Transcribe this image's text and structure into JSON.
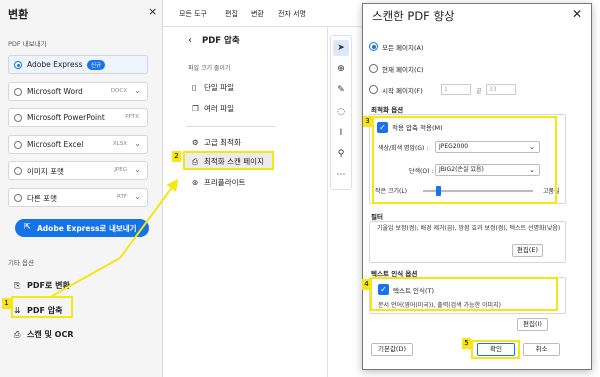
{
  "left": {
    "title": "변환",
    "close": "×",
    "export_heading": "PDF 내보내기",
    "formats": [
      {
        "label": "Adobe Express",
        "ext": "",
        "badge": "신규",
        "selected": true
      },
      {
        "label": "Microsoft Word",
        "ext": "DOCX",
        "badge": "",
        "selected": false
      },
      {
        "label": "Microsoft PowerPoint",
        "ext": "PPTX",
        "badge": "",
        "selected": false
      },
      {
        "label": "Microsoft Excel",
        "ext": "XLSX",
        "badge": "",
        "selected": false
      },
      {
        "label": "이미지 포맷",
        "ext": "JPEG",
        "badge": "",
        "selected": false
      },
      {
        "label": "다른 포맷",
        "ext": "RTF",
        "badge": "",
        "selected": false
      }
    ],
    "export_button": "Adobe Express로 내보내기",
    "other_heading": "기타 옵션",
    "other_items": [
      {
        "label": "PDF로 변환",
        "icon": "pdf-convert-icon"
      },
      {
        "label": "PDF 압축",
        "icon": "pdf-compress-icon"
      },
      {
        "label": "스캔 및 OCR",
        "icon": "scan-ocr-icon"
      }
    ]
  },
  "menu": [
    "모든 도구",
    "편집",
    "변환",
    "전자 서명"
  ],
  "middle": {
    "back": "‹",
    "title": "PDF 압축",
    "subtitle": "파일 크기 줄이기",
    "items": [
      "단일 파일",
      "여러 파일",
      "고급 최적화",
      "최적화 스캔 페이지",
      "프리플라이트"
    ]
  },
  "dialog": {
    "title": "스캔한 PDF 향상",
    "close": "✕",
    "pages": {
      "all": "모든 페이지(A)",
      "current": "현재 페이지(C)",
      "from": "시작 페이지(F)",
      "start_value": "1",
      "end_sep": "끝",
      "end_value": "33"
    },
    "optimize_heading": "최적화 옵션",
    "adaptive_compression": "적용 압축 적용(M)",
    "color_label": "색상/회색 명암(G) :",
    "color_value": "JPEG2000",
    "mono_label": "단색(O) :",
    "mono_value": "JBIG2(손실 있음)",
    "size_small": "작은 크기(L)",
    "size_high": "고품질",
    "filter_heading": "필터",
    "filter_desc": "기울임 보정(켬), 배경 제거(끔), 망점 효과 보정(켬), 텍스트 선명화(낮음)",
    "edit_e": "편집(E)",
    "ocr_heading": "텍스트 인식 옵션",
    "ocr_check": "텍스트 인식(T)",
    "ocr_desc": "문서 언어(영어(미국)), 출력(검색 가능한 이미지)",
    "edit_i": "편집(I)",
    "default_btn": "기본값(D)",
    "ok_btn": "확인",
    "cancel_btn": "취소"
  },
  "badges": [
    "1",
    "2",
    "3",
    "4",
    "5"
  ],
  "colors": {
    "accent": "#1473e6",
    "highlight": "#f5e614"
  }
}
